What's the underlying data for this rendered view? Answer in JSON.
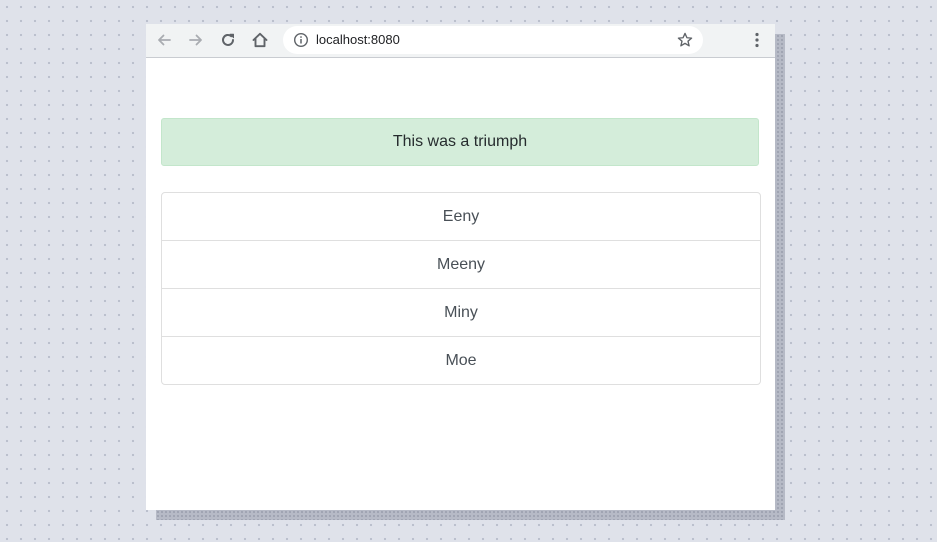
{
  "browser": {
    "address_bar": {
      "url": "localhost:8080",
      "info_icon": "info-circle-icon",
      "bookmark_icon": "star-outline-icon"
    },
    "nav_icons": {
      "back": "arrow-left-icon",
      "forward": "arrow-right-icon",
      "reload": "reload-icon",
      "home": "home-icon",
      "menu": "kebab-menu-icon"
    }
  },
  "page": {
    "alert": {
      "text": "This was a triumph",
      "background_color": "#d4edda"
    },
    "list": {
      "items": [
        {
          "label": "Eeny"
        },
        {
          "label": "Meeny"
        },
        {
          "label": "Miny"
        },
        {
          "label": "Moe"
        }
      ]
    }
  }
}
